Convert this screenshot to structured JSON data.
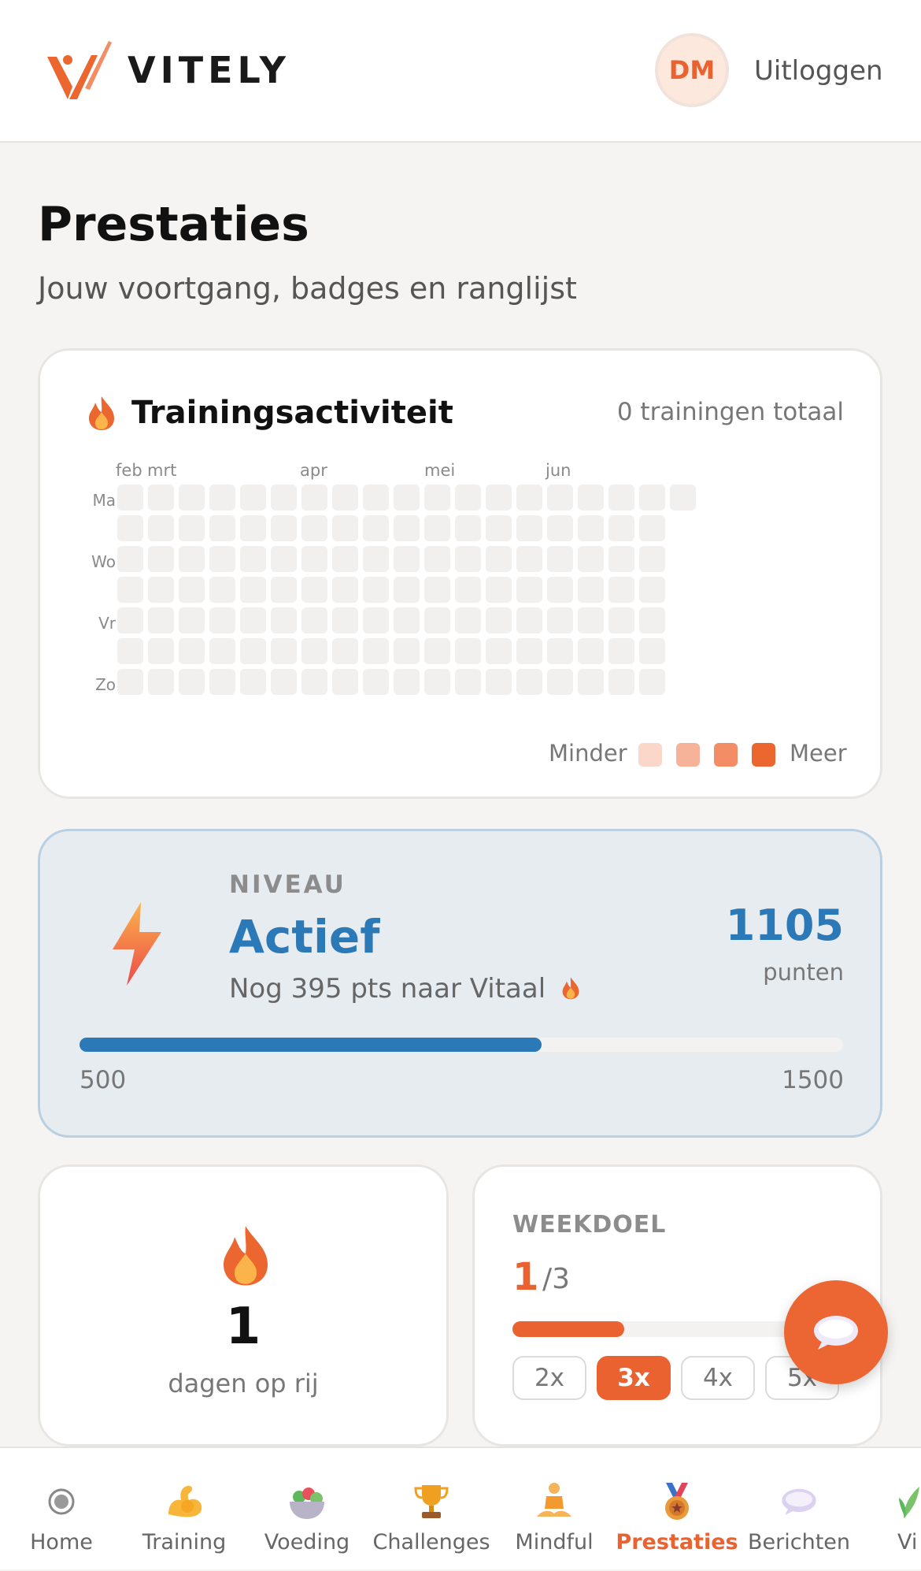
{
  "header": {
    "brand": "VITELY",
    "avatar_initials": "DM",
    "logout_label": "Uitloggen"
  },
  "page": {
    "title": "Prestaties",
    "subtitle": "Jouw voortgang, badges en ranglijst"
  },
  "activity": {
    "title": "Trainingsactiviteit",
    "total": "0 trainingen totaal",
    "months": [
      "feb",
      "mrt",
      "apr",
      "mei",
      "jun"
    ],
    "day_labels": [
      "Ma",
      "Wo",
      "Vr",
      "Zo"
    ],
    "legend_less": "Minder",
    "legend_more": "Meer",
    "legend_colors": [
      "#fbd7c9",
      "#f7b399",
      "#f28d66",
      "#ec6630"
    ]
  },
  "level": {
    "label": "NIVEAU",
    "name": "Actief",
    "next": "Nog 395 pts naar Vitaal",
    "points": "1105",
    "points_label": "punten",
    "min": "500",
    "max": "1500",
    "progress": 0.605
  },
  "streak": {
    "value": "1",
    "label": "dagen op rij"
  },
  "weekgoal": {
    "label": "WEEKDOEL",
    "current": "1",
    "total": "/3",
    "progress": 0.333,
    "options": [
      "2x",
      "3x",
      "4x",
      "5x"
    ],
    "selected": "3x"
  },
  "nav": {
    "items": [
      {
        "label": "Home"
      },
      {
        "label": "Training"
      },
      {
        "label": "Voeding"
      },
      {
        "label": "Challenges"
      },
      {
        "label": "Mindful"
      },
      {
        "label": "Prestaties"
      },
      {
        "label": "Berichten"
      },
      {
        "label": "Vi"
      }
    ],
    "active": "Prestaties"
  },
  "colors": {
    "accent": "#ea6230",
    "level_blue": "#2b79b6"
  }
}
